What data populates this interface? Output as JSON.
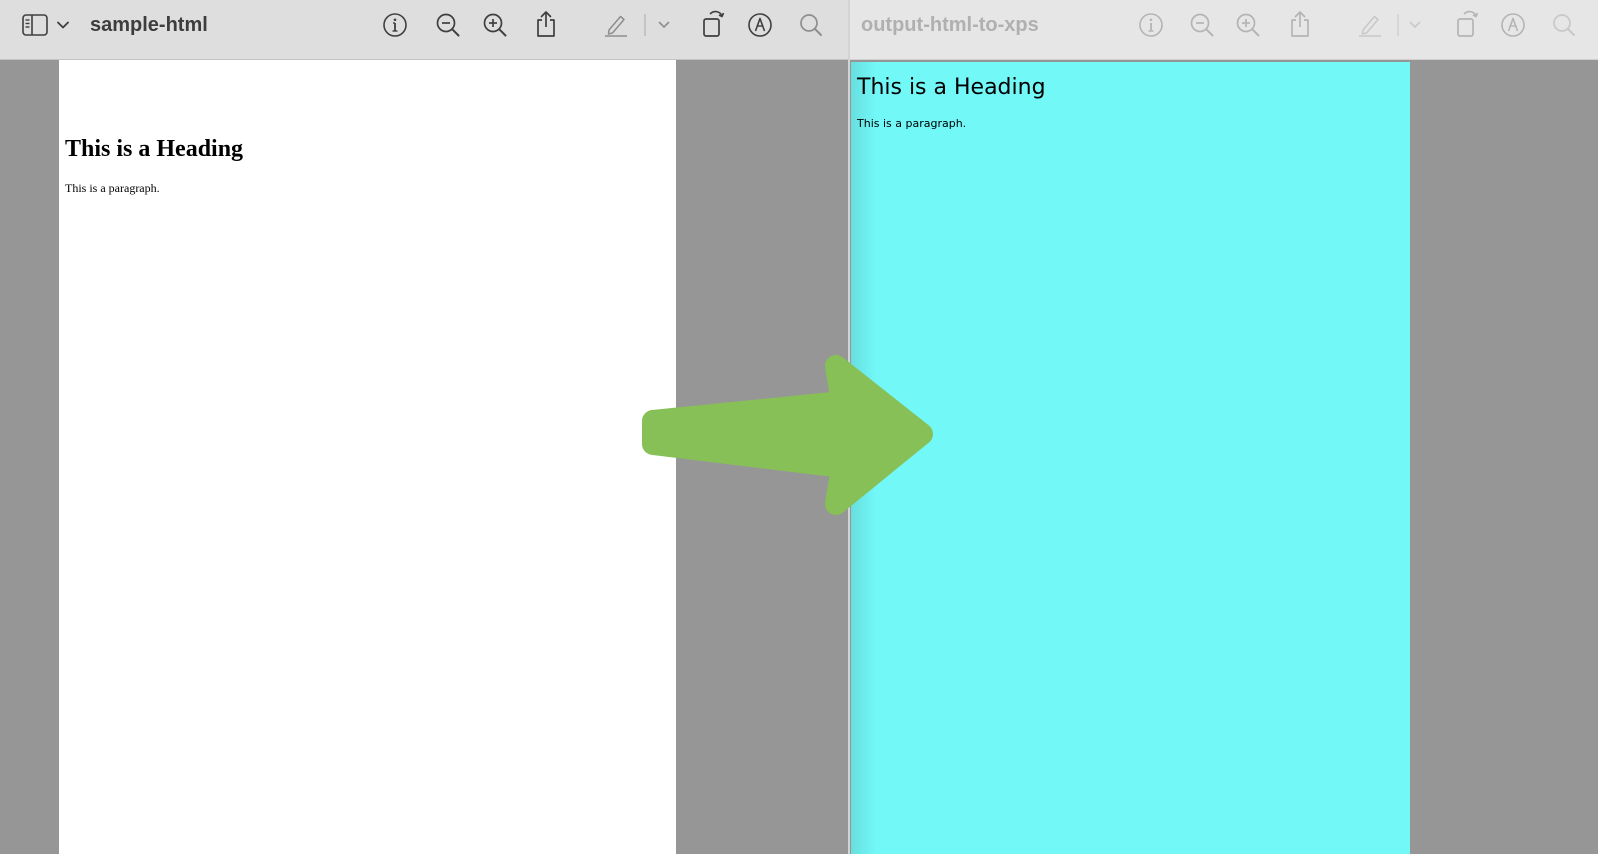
{
  "left_window": {
    "title": "sample-html",
    "document": {
      "heading": "This is a Heading",
      "paragraph": "This is a paragraph."
    }
  },
  "right_window": {
    "title": "output-html-to-xps",
    "document": {
      "heading": "This is a Heading",
      "paragraph": "This is a paragraph.",
      "background_color": "#73f8f8"
    }
  },
  "toolbar_icons": [
    "sidebar-icon",
    "chevron-down-icon",
    "info-icon",
    "zoom-out-icon",
    "zoom-in-icon",
    "share-icon",
    "highlight-pen-icon",
    "rotate-icon",
    "markup-icon",
    "search-icon"
  ],
  "colors": {
    "arrow": "#87c057",
    "workspace": "#969696",
    "active_toolbar": "#dedede",
    "inactive_toolbar": "#e6e6e6",
    "active_title": "#3d3d3d",
    "inactive_title": "#b0b0b0"
  }
}
